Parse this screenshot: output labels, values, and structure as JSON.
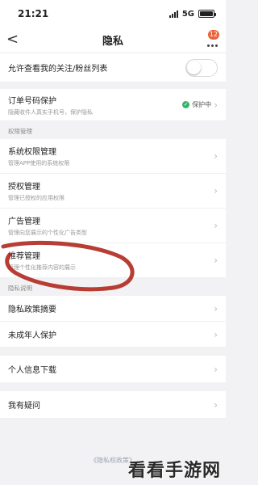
{
  "status": {
    "time": "21:21",
    "network": "5G"
  },
  "nav": {
    "title": "隐私",
    "back_glyph": "<",
    "badge": "12"
  },
  "follow_list": {
    "label": "允许查看我的关注/粉丝列表",
    "toggle_on": false
  },
  "phone_protect": {
    "label": "订单号码保护",
    "sub": "隐藏收件人真实手机号，保护隐私",
    "status": "保护中",
    "status_color": "#34b36b"
  },
  "section_permissions": "权限管理",
  "permissions": [
    {
      "label": "系统权限管理",
      "sub": "管理APP使用的系统权限"
    },
    {
      "label": "授权管理",
      "sub": "管理已授权的应用权限"
    },
    {
      "label": "广告管理",
      "sub": "管理向您展示的个性化广告类型"
    },
    {
      "label": "推荐管理",
      "sub": "管理个性化推荐内容的展示"
    }
  ],
  "section_privacy": "隐私说明",
  "privacy": [
    {
      "label": "隐私政策摘要"
    },
    {
      "label": "未成年人保护"
    }
  ],
  "more": [
    {
      "label": "个人信息下载"
    },
    {
      "label": "我有疑问"
    }
  ],
  "footer": {
    "link": "《隐私权政策》"
  },
  "watermark": "看看手游网",
  "colors": {
    "accent": "#e8653a",
    "annotation": "#b0281e"
  }
}
